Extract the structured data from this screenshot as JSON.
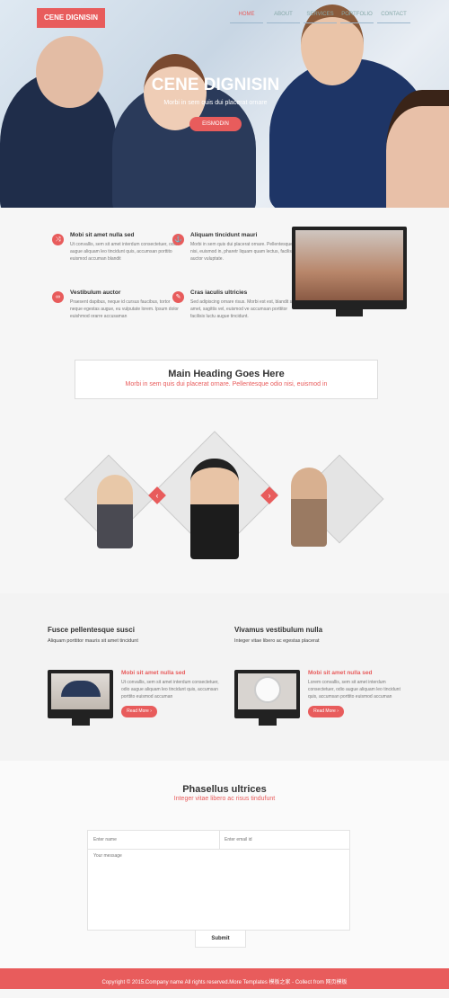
{
  "brand": "CENE DIGNISIN",
  "nav": [
    "HOME",
    "ABOUT",
    "SERVICES",
    "PORTFOLIO",
    "CONTACT"
  ],
  "hero": {
    "title": "CENE DIGNISIN",
    "subtitle": "Morbi in sem quis dui placerat ornare",
    "button": "EISMODIN"
  },
  "features": [
    {
      "icon": "shuffle-icon",
      "glyph": "⤨",
      "title": "Mobi sit amet nulla sed",
      "text": "Ut convallis, sem sit amet interdum consectetuer, odio augue aliquam leo tincidunt quis, accumsan porttito euismod accuman blandit"
    },
    {
      "icon": "anchor-icon",
      "glyph": "⚓",
      "title": "Aliquam tincidunt mauri",
      "text": "Morbi in sem quis dui placerat ornare. Pellentesque odio nisi, euismod in, pharetr liquam quam lectus, facilisis auctor vuluptate."
    },
    {
      "icon": "link-icon",
      "glyph": "∞",
      "title": "Vestibulum auctor",
      "text": "Praesent dapibus, neque id cursus faucibus, tortor neque egestas augue, eu vulputate lorem. Ipsum dolor euishmod orarre accusaman"
    },
    {
      "icon": "pencil-icon",
      "glyph": "✎",
      "title": "Cras iaculis ultricies",
      "text": "Sed adipiscing ornare risus. Morbi est est, blandit sit amet, sagittis vel, euismod ve accumsan porttitor facilisis luctu augue tincidunt."
    }
  ],
  "heading": {
    "title": "Main Heading Goes Here",
    "subtitle": "Morbi in sem quis dui placerat ornare. Pellentesque odio nisi, euismod in"
  },
  "carousel": {
    "prev": "‹",
    "next": "›"
  },
  "columns": [
    {
      "title": "Fusce pellentesque susci",
      "subtitle": "Aliquam porttitor mauris sit amet tincidunt",
      "item": {
        "title": "Mobi sit amet nulla sed",
        "text": "Ut convallis, sem sit amet interdum consectetuer, odio augue aliquam leo tincidunt quis, accumsan porttito euismod accuman",
        "button": "Read More"
      }
    },
    {
      "title": "Vivamus vestibulum nulla",
      "subtitle": "Integer vitae libero ac egestas placerat",
      "item": {
        "title": "Mobi sit amet nulla sed",
        "text": "Lorem convallis, sem sit amet interdum consectetuer, odio augue aliquam leo tincidunt quis, accumsan porttito euismod accuman",
        "button": "Read More"
      }
    }
  ],
  "contact": {
    "title": "Phasellus ultrices",
    "subtitle": "Integer vitae libero ac risus tindufunt",
    "name_placeholder": "Enter name",
    "email_placeholder": "Enter email id",
    "message_placeholder": "Your message",
    "submit": "Submit"
  },
  "footer": "Copyright © 2015.Company name All rights reserved.More Templates 模板之家 - Collect from 网页模板",
  "colors": {
    "accent": "#e85c5c"
  }
}
